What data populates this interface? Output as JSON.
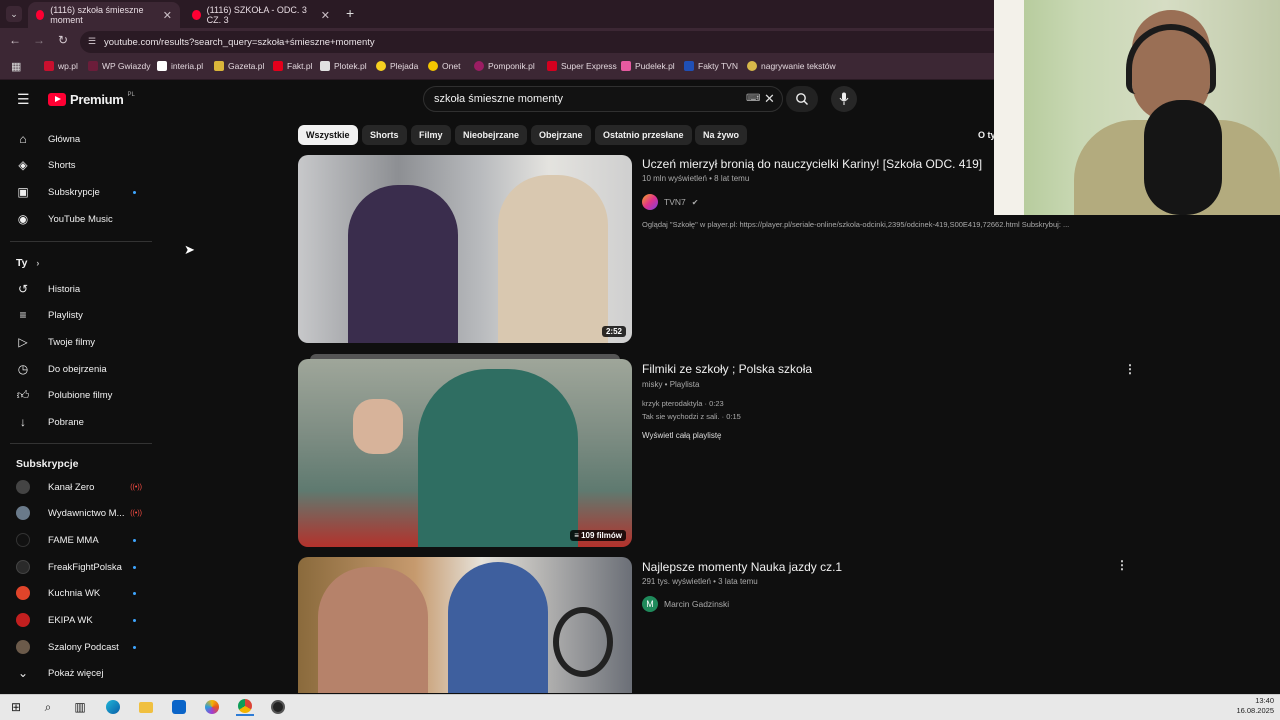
{
  "browser": {
    "tabs": [
      {
        "title": "(1116) szkoła śmieszne moment",
        "active": true
      },
      {
        "title": "(1116) SZKOŁA - ODC. 3 CZ. 3",
        "active": false
      }
    ],
    "new_tab": "+",
    "url": "youtube.com/results?search_query=szkoła+śmieszne+momenty",
    "bookmarks": [
      "wp.pl",
      "WP Gwiazdy",
      "interia.pl",
      "Gazeta.pl",
      "Fakt.pl",
      "Plotek.pl",
      "Plejada",
      "Onet",
      "Pomponik.pl",
      "Super Express",
      "Pudelek.pl",
      "Fakty TVN",
      "nagrywanie tekstów"
    ]
  },
  "youtube": {
    "logo_text": "Premium",
    "logo_region": "PL",
    "search_value": "szkoła śmieszne momenty",
    "nav": [
      {
        "label": "Główna",
        "icon": "home-icon"
      },
      {
        "label": "Shorts",
        "icon": "shorts-icon"
      },
      {
        "label": "Subskrypcje",
        "icon": "subscriptions-icon"
      },
      {
        "label": "YouTube Music",
        "icon": "music-icon"
      }
    ],
    "you_header": "Ty",
    "you_items": [
      {
        "label": "Historia",
        "icon": "history-icon"
      },
      {
        "label": "Playlisty",
        "icon": "playlist-icon"
      },
      {
        "label": "Twoje filmy",
        "icon": "your-videos-icon"
      },
      {
        "label": "Do obejrzenia",
        "icon": "watch-later-icon"
      },
      {
        "label": "Polubione filmy",
        "icon": "like-icon"
      },
      {
        "label": "Pobrane",
        "icon": "download-icon"
      }
    ],
    "subs_header": "Subskrypcje",
    "subs": [
      {
        "label": "Kanał Zero",
        "status": "live",
        "color": "#444444"
      },
      {
        "label": "Wydawnictwo M...",
        "status": "live",
        "color": "#6a7a8a"
      },
      {
        "label": "FAME MMA",
        "status": "dot",
        "color": "#111111"
      },
      {
        "label": "FreakFightPolska",
        "status": "dot",
        "color": "#2a2a2a"
      },
      {
        "label": "Kuchnia WK",
        "status": "dot",
        "color": "#e0442a"
      },
      {
        "label": "EKIPA WK",
        "status": "dot",
        "color": "#c21f1f"
      },
      {
        "label": "Szalony Podcast",
        "status": "dot",
        "color": "#6b5a4a"
      }
    ],
    "show_more": "Pokaż więcej",
    "chips": [
      "Wszystkie",
      "Shorts",
      "Filmy",
      "Nieobejrzane",
      "Obejrzane",
      "Ostatnio przesłane",
      "Na żywo"
    ],
    "chip_overflow": "O ty",
    "results": [
      {
        "title": "Uczeń mierzył bronią do nauczycielki Kariny! [Szkoła ODC. 419]",
        "meta": "10 mln wyświetleń • 8 lat temu",
        "channel": "TVN7",
        "verified": true,
        "description": "Oglądaj \"Szkołę\" w player.pl: https://player.pl/seriale-online/szkola-odcinki,2395/odcinek-419,S00E419,72662.html Subskrybuj: ...",
        "duration": "2:52"
      },
      {
        "title": "Filmiki ze szkoły ; Polska szkoła",
        "meta": "misky • Playlista",
        "items": [
          "krzyk pterodaktyla · 0:23",
          "Tak sie wychodzi z sali. · 0:15"
        ],
        "link": "Wyświetl całą playlistę",
        "badge": "109 filmów"
      },
      {
        "title": "Najlepsze momenty Nauka jazdy cz.1",
        "meta": "291 tys. wyświetleń • 3 lata temu",
        "channel": "Marcin Gadzinski",
        "channel_initial": "M"
      }
    ]
  },
  "taskbar": {
    "time": "13:40",
    "date": "16.08.2025"
  }
}
